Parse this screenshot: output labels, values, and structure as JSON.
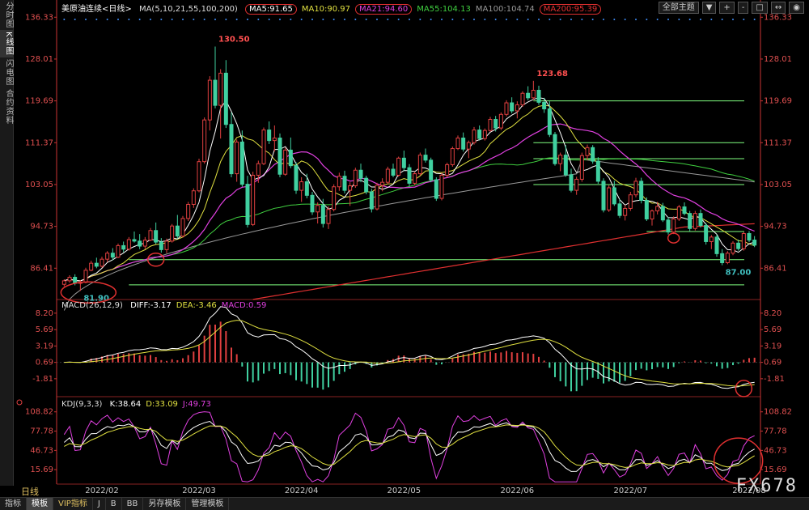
{
  "window": {
    "title": "美原油连续<日线>",
    "side_tabs": [
      "分时图",
      "K线图",
      "闪电图",
      "合约资料"
    ],
    "active_side_tab": 1,
    "top_buttons": [
      "全部主题",
      "▼",
      "+",
      "-",
      "□",
      "↔",
      "◉"
    ],
    "bottom_tabs": [
      "指标",
      "模板",
      "VIP指标",
      "J",
      "B",
      "BB",
      "另存模板",
      "管理模板"
    ],
    "active_bottom_tab": 1,
    "period_label": "日线",
    "watermark": "FX678"
  },
  "colors": {
    "up": "#e04040",
    "down": "#40d0a0",
    "ma5": "#ffffff",
    "ma10": "#e0e040",
    "ma21": "#e040e0",
    "ma55": "#40d040",
    "ma100": "#999999",
    "ma200": "#e03030",
    "hline": "#80ff80",
    "annotation": "#e03030",
    "axis": "#cc3333",
    "label": "#ff5050",
    "dot_blue": "#4090ff"
  },
  "legends": {
    "ma": {
      "name": "MA(5,10,21,55,100,200)",
      "items": [
        {
          "key": "ma5",
          "label": "MA5:91.65"
        },
        {
          "key": "ma10",
          "label": "MA10:90.97"
        },
        {
          "key": "ma21",
          "label": "MA21:94.60"
        },
        {
          "key": "ma55",
          "label": "MA55:104.13"
        },
        {
          "key": "ma100",
          "label": "MA100:104.74"
        },
        {
          "key": "ma200",
          "label": "MA200:95.39"
        }
      ]
    },
    "macd": {
      "name": "MACD(26,12,9)",
      "items": [
        {
          "key": "diff",
          "label": "DIFF:-3.17",
          "color": "#ffffff"
        },
        {
          "key": "dea",
          "label": "DEA:-3.46",
          "color": "#e0e040"
        },
        {
          "key": "macd",
          "label": "MACD:0.59",
          "color": "#e040e0"
        }
      ]
    },
    "kdj": {
      "name": "KDJ(9,3,3)",
      "items": [
        {
          "key": "k",
          "label": "K:38.64",
          "color": "#ffffff"
        },
        {
          "key": "d",
          "label": "D:33.09",
          "color": "#e0e040"
        },
        {
          "key": "j",
          "label": "J:49.73",
          "color": "#e040e0"
        }
      ]
    }
  },
  "chart_data": [
    {
      "type": "candlestick",
      "panel": "price",
      "y_ticks": [
        "136.33",
        "128.01",
        "119.69",
        "111.37",
        "103.05",
        "94.73",
        "86.41"
      ],
      "ylim": [
        80.5,
        137.5
      ],
      "x_tick_labels": [
        "2022/02",
        "2022/03",
        "2022/04",
        "2022/05",
        "2022/06",
        "2022/07",
        "2022/08"
      ],
      "x_tick_index": [
        7,
        25,
        44,
        63,
        84,
        105,
        127
      ],
      "ohlc": [
        [
          83.2,
          84.2,
          82.8,
          83.9
        ],
        [
          83.9,
          85.0,
          83.5,
          84.6
        ],
        [
          84.6,
          85.2,
          83.0,
          83.4
        ],
        [
          83.4,
          84.0,
          81.9,
          83.6
        ],
        [
          83.6,
          86.5,
          83.4,
          86.0
        ],
        [
          86.0,
          87.9,
          85.8,
          87.4
        ],
        [
          87.4,
          88.5,
          86.4,
          86.8
        ],
        [
          86.8,
          88.7,
          86.5,
          88.2
        ],
        [
          88.2,
          89.8,
          87.6,
          89.4
        ],
        [
          89.4,
          90.4,
          88.0,
          88.6
        ],
        [
          88.6,
          91.3,
          88.4,
          90.9
        ],
        [
          90.9,
          91.7,
          89.6,
          90.2
        ],
        [
          90.2,
          92.6,
          89.9,
          92.1
        ],
        [
          92.1,
          93.7,
          91.5,
          91.8
        ],
        [
          91.8,
          93.2,
          90.2,
          90.8
        ],
        [
          90.8,
          92.6,
          90.2,
          92.0
        ],
        [
          92.0,
          94.4,
          91.8,
          93.9
        ],
        [
          93.9,
          95.5,
          91.2,
          91.6
        ],
        [
          91.6,
          92.4,
          89.5,
          90.1
        ],
        [
          90.1,
          92.3,
          89.4,
          91.8
        ],
        [
          91.8,
          95.2,
          91.5,
          94.8
        ],
        [
          94.8,
          97.0,
          92.3,
          92.8
        ],
        [
          92.8,
          96.8,
          92.5,
          96.3
        ],
        [
          96.3,
          99.6,
          95.8,
          99.1
        ],
        [
          99.1,
          102.3,
          98.4,
          101.8
        ],
        [
          101.8,
          108.2,
          101.5,
          107.6
        ],
        [
          107.6,
          116.4,
          107.2,
          115.9
        ],
        [
          115.9,
          124.6,
          113.8,
          123.8
        ],
        [
          123.8,
          130.5,
          118.2,
          118.8
        ],
        [
          118.8,
          126.0,
          112.2,
          125.2
        ],
        [
          125.2,
          127.8,
          114.3,
          115.0
        ],
        [
          115.0,
          117.4,
          104.5,
          105.2
        ],
        [
          105.2,
          112.0,
          103.6,
          111.5
        ],
        [
          111.5,
          113.8,
          102.6,
          103.1
        ],
        [
          103.1,
          104.8,
          94.5,
          95.1
        ],
        [
          95.1,
          105.6,
          94.8,
          104.9
        ],
        [
          104.9,
          107.8,
          103.4,
          107.2
        ],
        [
          107.2,
          114.4,
          106.9,
          113.9
        ],
        [
          113.9,
          115.6,
          111.1,
          111.8
        ],
        [
          111.8,
          114.8,
          109.6,
          112.3
        ],
        [
          112.3,
          113.2,
          104.5,
          105.1
        ],
        [
          105.1,
          110.4,
          104.8,
          109.9
        ],
        [
          109.9,
          112.4,
          106.3,
          106.8
        ],
        [
          106.8,
          107.5,
          101.2,
          101.9
        ],
        [
          101.9,
          104.5,
          99.6,
          103.6
        ],
        [
          103.6,
          105.2,
          100.3,
          100.9
        ],
        [
          100.9,
          101.6,
          97.0,
          97.6
        ],
        [
          97.6,
          99.5,
          95.3,
          98.9
        ],
        [
          98.9,
          100.2,
          94.5,
          95.3
        ],
        [
          95.3,
          98.7,
          94.2,
          98.1
        ],
        [
          98.1,
          103.1,
          97.7,
          102.6
        ],
        [
          102.6,
          105.4,
          101.8,
          104.7
        ],
        [
          104.7,
          105.8,
          101.3,
          101.9
        ],
        [
          101.9,
          103.5,
          98.8,
          102.8
        ],
        [
          102.8,
          106.4,
          102.4,
          105.9
        ],
        [
          105.9,
          107.2,
          103.5,
          104.3
        ],
        [
          104.3,
          104.8,
          101.1,
          101.6
        ],
        [
          101.6,
          102.2,
          97.5,
          98.2
        ],
        [
          98.2,
          103.4,
          97.9,
          102.9
        ],
        [
          102.9,
          104.3,
          101.7,
          103.5
        ],
        [
          103.5,
          106.6,
          103.1,
          106.1
        ],
        [
          106.1,
          107.2,
          104.5,
          104.9
        ],
        [
          104.9,
          108.6,
          104.6,
          108.3
        ],
        [
          108.3,
          109.8,
          105.8,
          106.4
        ],
        [
          106.4,
          107.1,
          102.6,
          103.3
        ],
        [
          103.3,
          105.6,
          102.9,
          105.2
        ],
        [
          105.2,
          109.4,
          104.8,
          108.9
        ],
        [
          108.9,
          110.2,
          107.4,
          107.9
        ],
        [
          107.9,
          108.4,
          103.5,
          104.0
        ],
        [
          104.0,
          104.5,
          99.8,
          100.3
        ],
        [
          100.3,
          105.4,
          99.9,
          104.9
        ],
        [
          104.9,
          107.4,
          104.5,
          107.0
        ],
        [
          107.0,
          110.6,
          106.6,
          110.2
        ],
        [
          110.2,
          112.8,
          109.9,
          112.3
        ],
        [
          112.3,
          113.4,
          109.6,
          110.1
        ],
        [
          110.1,
          111.8,
          108.3,
          111.4
        ],
        [
          111.4,
          114.5,
          111.0,
          113.9
        ],
        [
          113.9,
          114.8,
          111.8,
          112.2
        ],
        [
          112.2,
          114.2,
          111.8,
          113.8
        ],
        [
          113.8,
          116.5,
          113.5,
          116.0
        ],
        [
          116.0,
          116.7,
          113.6,
          114.3
        ],
        [
          114.3,
          117.4,
          113.9,
          117.0
        ],
        [
          117.0,
          119.8,
          116.6,
          119.3
        ],
        [
          119.3,
          120.4,
          117.2,
          117.7
        ],
        [
          117.7,
          119.6,
          116.2,
          118.9
        ],
        [
          118.9,
          121.6,
          118.5,
          121.2
        ],
        [
          121.2,
          122.6,
          119.8,
          120.3
        ],
        [
          120.3,
          123.68,
          119.9,
          121.8
        ],
        [
          121.8,
          122.7,
          118.9,
          119.4
        ],
        [
          119.4,
          120.3,
          117.3,
          118.1
        ],
        [
          118.1,
          119.6,
          112.5,
          113.0
        ],
        [
          113.0,
          113.5,
          106.8,
          107.2
        ],
        [
          107.2,
          109.4,
          105.7,
          108.9
        ],
        [
          108.9,
          110.9,
          104.6,
          105.0
        ],
        [
          105.0,
          106.2,
          101.5,
          101.9
        ],
        [
          101.9,
          104.6,
          101.0,
          104.1
        ],
        [
          104.1,
          109.4,
          103.6,
          108.8
        ],
        [
          108.8,
          111.0,
          107.9,
          110.4
        ],
        [
          110.4,
          110.9,
          107.2,
          107.7
        ],
        [
          107.7,
          108.5,
          103.2,
          103.7
        ],
        [
          103.7,
          104.3,
          97.5,
          98.0
        ],
        [
          98.0,
          102.9,
          97.6,
          102.4
        ],
        [
          102.4,
          103.8,
          98.8,
          99.2
        ],
        [
          99.2,
          100.1,
          96.4,
          96.9
        ],
        [
          96.9,
          99.0,
          95.9,
          98.3
        ],
        [
          98.3,
          101.6,
          97.8,
          101.0
        ],
        [
          101.0,
          104.4,
          100.5,
          103.7
        ],
        [
          103.7,
          104.4,
          99.3,
          99.9
        ],
        [
          99.9,
          100.5,
          95.8,
          96.2
        ],
        [
          96.2,
          98.1,
          94.9,
          97.8
        ],
        [
          97.8,
          99.6,
          97.1,
          98.7
        ],
        [
          98.7,
          99.4,
          95.6,
          96.0
        ],
        [
          96.0,
          96.6,
          93.1,
          93.6
        ],
        [
          93.6,
          96.7,
          93.2,
          96.2
        ],
        [
          96.2,
          99.0,
          95.8,
          98.6
        ],
        [
          98.6,
          99.5,
          96.9,
          97.3
        ],
        [
          97.3,
          97.8,
          93.8,
          94.3
        ],
        [
          94.3,
          97.8,
          93.9,
          97.3
        ],
        [
          97.3,
          98.1,
          94.5,
          94.9
        ],
        [
          94.9,
          95.4,
          91.1,
          91.7
        ],
        [
          91.7,
          93.0,
          90.2,
          92.6
        ],
        [
          92.6,
          93.1,
          88.7,
          89.3
        ],
        [
          89.3,
          90.2,
          87.0,
          87.5
        ],
        [
          87.5,
          89.8,
          87.2,
          89.4
        ],
        [
          89.4,
          91.8,
          89.0,
          91.4
        ],
        [
          91.4,
          92.1,
          89.9,
          90.3
        ],
        [
          90.3,
          93.6,
          89.9,
          93.3
        ],
        [
          93.3,
          93.8,
          91.6,
          92.0
        ],
        [
          92.0,
          92.8,
          90.6,
          91.0
        ]
      ],
      "horizontal_levels": [
        119.69,
        111.37,
        108.2,
        103.05,
        93.7,
        88.1,
        83.1
      ],
      "annotations": [
        {
          "label": "130.50",
          "index": 28,
          "value": 130.5,
          "position": "above"
        },
        {
          "label": "123.68",
          "index": 87,
          "value": 123.68,
          "position": "above"
        },
        {
          "label": "81.90",
          "index": 3,
          "value": 81.9,
          "position": "below"
        },
        {
          "label": "87.00",
          "index": 122,
          "value": 87.0,
          "position": "below"
        }
      ]
    },
    {
      "type": "macd",
      "panel": "macd",
      "y_ticks": [
        "8.20",
        "5.69",
        "3.19",
        "0.69",
        "-1.81"
      ],
      "ylim": [
        -4.3,
        8.8
      ]
    },
    {
      "type": "kdj",
      "panel": "kdj",
      "y_ticks": [
        "108.82",
        "77.78",
        "46.73",
        "15.69"
      ],
      "ylim": [
        -5,
        115
      ]
    }
  ]
}
